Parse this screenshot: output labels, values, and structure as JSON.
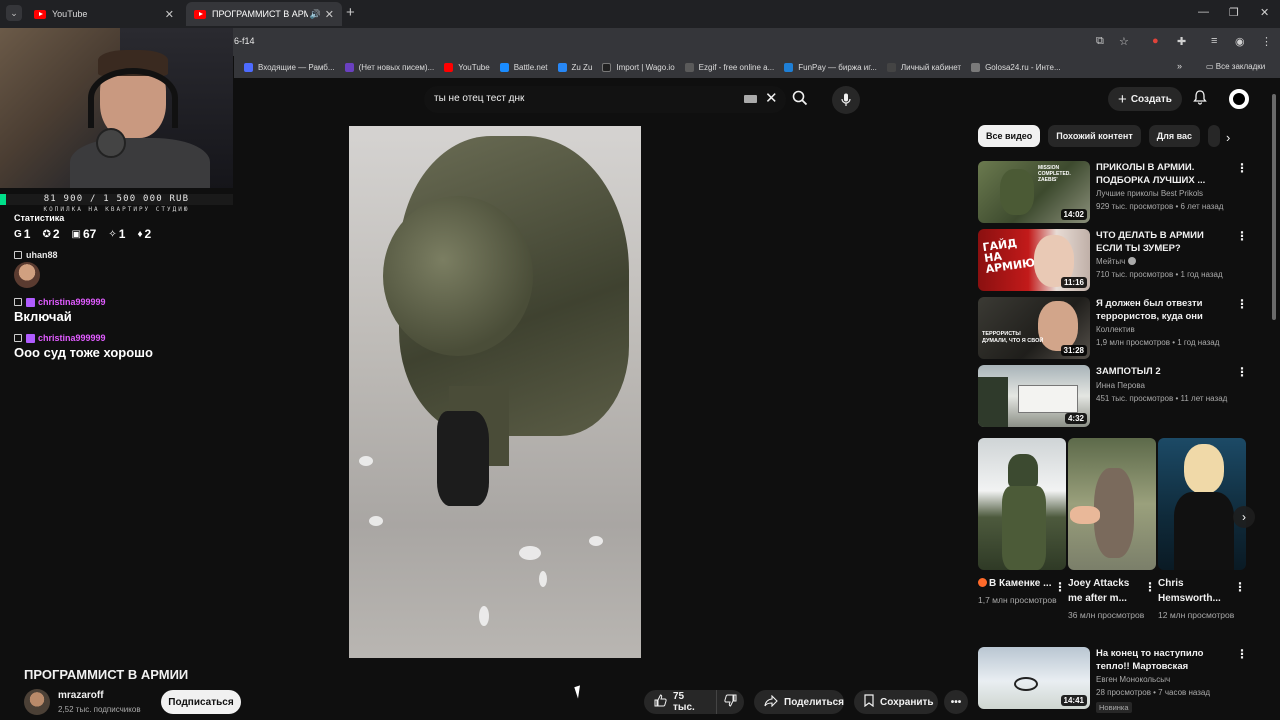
{
  "browser": {
    "tabs": [
      {
        "title": "YouTube",
        "active": false
      },
      {
        "title": "ПРОГРАММИСТ В АРМИИ",
        "active": true
      }
    ],
    "url": "6-f14",
    "bookmarks": [
      {
        "label": "Входящие — Рамб...",
        "color": "#4d6bff"
      },
      {
        "label": "(Нет новых писем)...",
        "color": "#6a40c0"
      },
      {
        "label": "YouTube",
        "color": "#ff0000"
      },
      {
        "label": "Battle.net",
        "color": "#1a8cff"
      },
      {
        "label": "Zu Zu",
        "color": "#2787f5"
      },
      {
        "label": "Import | Wago.io",
        "color": "#202020"
      },
      {
        "label": "Ezgif - free online a...",
        "color": "#5a5a5a"
      },
      {
        "label": "FunPay — биржа иг...",
        "color": "#1e7fd6"
      },
      {
        "label": "Личный кабинет",
        "color": "#444444"
      },
      {
        "label": "Golosa24.ru - Инте...",
        "color": "#7a7a7a"
      }
    ],
    "bookmarks_more": "»",
    "all_bookmarks": "Все закладки"
  },
  "overlay": {
    "goal_text": "81 900 / 1 500 000 RUB",
    "goal_progress": 0.0546,
    "goal_sub": "КОПИЛКА НА КВАРТИРУ СТУДИЮ",
    "stats_title": "Статистика",
    "stats": [
      "1",
      "2",
      "67",
      "1",
      "2"
    ],
    "chat": [
      {
        "user": "uhan88",
        "message": ""
      },
      {
        "user": "christina999999",
        "message": "Включай"
      },
      {
        "user": "christina999999",
        "message": "Ооо суд тоже хорошо"
      }
    ]
  },
  "youtube": {
    "search_value": "ты не отец тест днк",
    "create_label": "Создать",
    "video_title": "ПРОГРАММИСТ В АРМИИ",
    "channel_name": "mrazaroff",
    "channel_subs": "2,52 тыс. подписчиков",
    "subscribe_label": "Подписаться",
    "likes": "75 тыс.",
    "share_label": "Поделиться",
    "save_label": "Сохранить",
    "chips": [
      "Все видео",
      "Похожий контент",
      "Для вас"
    ],
    "recommendations": [
      {
        "title": "ПРИКОЛЫ В АРМИИ. ПОДБОРКА ЛУЧШИХ ...",
        "channel": "Лучшие приколы Best Prikols",
        "meta": "929 тыс. просмотров • 6 лет назад",
        "duration": "14:02",
        "thumb_text": "MISSION COMPLETED. ZAEBIS'"
      },
      {
        "title": "ЧТО ДЕЛАТЬ В АРМИИ ЕСЛИ ТЫ ЗУМЕР?",
        "channel": "Мейтыч",
        "meta": "710 тыс. просмотров • 1 год назад",
        "duration": "11:16",
        "thumb_text": "ГАЙД НА АРМИЮ"
      },
      {
        "title": "Я должен был отвезти террористов, куда они скажут",
        "channel": "Коллектив",
        "meta": "1,9 млн просмотров • 1 год назад",
        "duration": "31:28",
        "thumb_text": "ТЕРРОРИСТЫ ДУМАЛИ, ЧТО Я СВОЙ"
      },
      {
        "title": "ЗАМПОТЫЛ 2",
        "channel": "Инна Перова",
        "meta": "451 тыс. просмотров • 11 лет назад",
        "duration": "4:32",
        "thumb_text": ""
      },
      {
        "title": "На конец то наступило тепло!! Мартовская поездка на ...",
        "channel": "Евген Монокольсыч",
        "meta": "28 просмотров • 7 часов назад",
        "duration": "14:41",
        "badge": "Новинка",
        "thumb_text": ""
      }
    ],
    "shorts": [
      {
        "title": "В Каменке ...",
        "views": "1,7 млн просмотров",
        "live": true
      },
      {
        "title": "Joey Attacks me after m...",
        "views": "36 млн просмотров",
        "live": false
      },
      {
        "title": "Chris Hemsworth...",
        "views": "12 млн просмотров",
        "live": false
      }
    ]
  },
  "colors": {
    "accent": "#ff0000",
    "background": "#0f0f0f",
    "goal": "#00e08a",
    "chat_user_highlight": "#e05cff"
  }
}
